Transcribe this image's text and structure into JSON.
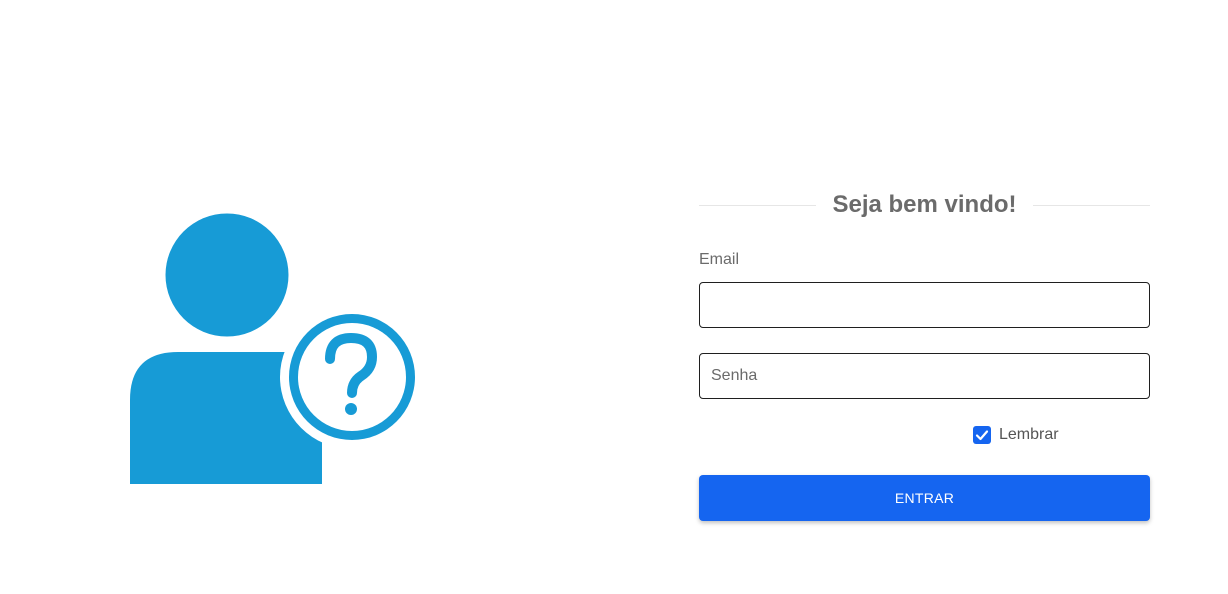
{
  "illustration": {
    "icon": "user-question-icon",
    "color": "#179bd6"
  },
  "login": {
    "title": "Seja bem vindo!",
    "email_label": "Email",
    "email_value": "",
    "password_placeholder": "Senha",
    "password_value": "",
    "remember_label": "Lembrar",
    "remember_checked": true,
    "submit_label": "ENTRAR"
  },
  "colors": {
    "primary": "#1565f0",
    "illustration": "#179bd6",
    "text_muted": "#6b6b6b"
  }
}
